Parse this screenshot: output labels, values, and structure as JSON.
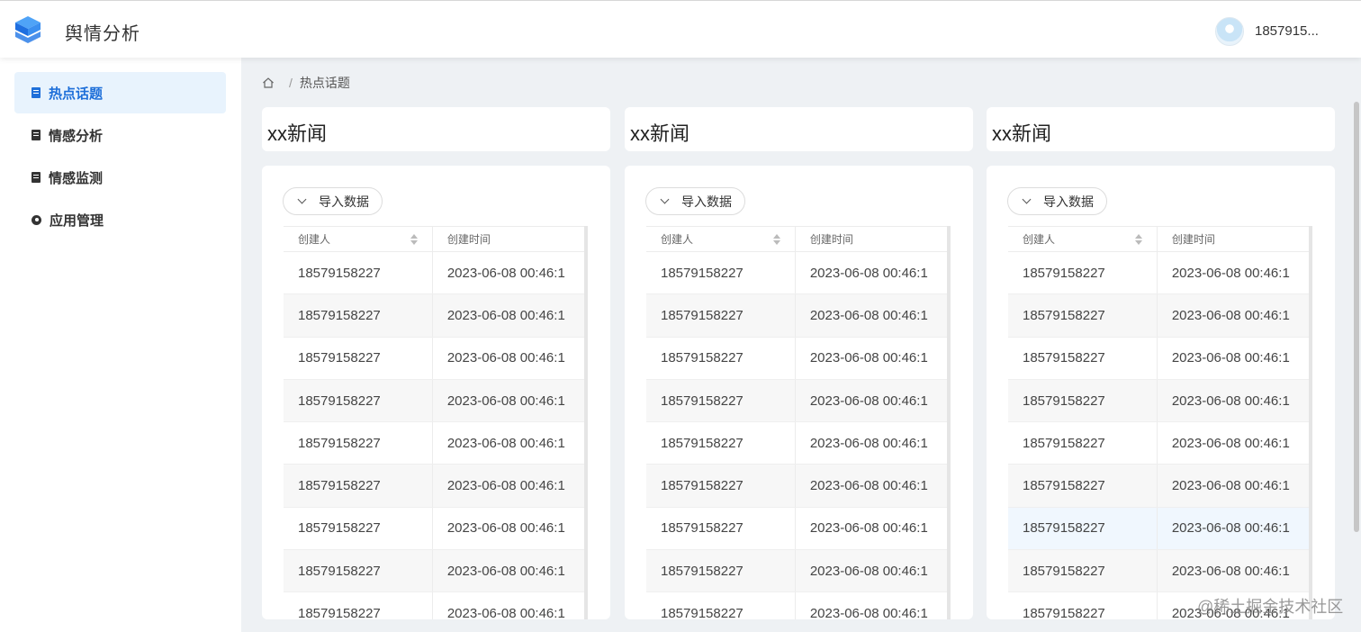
{
  "header": {
    "app_title": "舆情分析",
    "user_name": "1857915..."
  },
  "sidebar": {
    "items": [
      {
        "label": "热点话题",
        "icon": "document-icon",
        "active": true
      },
      {
        "label": "情感分析",
        "icon": "document-icon",
        "active": false
      },
      {
        "label": "情感监测",
        "icon": "document-icon",
        "active": false
      },
      {
        "label": "应用管理",
        "icon": "gear-icon",
        "active": false
      }
    ]
  },
  "breadcrumb": {
    "separator": "/",
    "current": "热点话题"
  },
  "panels": [
    {
      "title": "xx新闻",
      "import_label": "导入数据"
    },
    {
      "title": "xx新闻",
      "import_label": "导入数据"
    },
    {
      "title": "xx新闻",
      "import_label": "导入数据"
    }
  ],
  "table": {
    "columns": [
      "创建人",
      "创建时间"
    ],
    "rows": [
      [
        "18579158227",
        "2023-06-08 00:46:1"
      ],
      [
        "18579158227",
        "2023-06-08 00:46:1"
      ],
      [
        "18579158227",
        "2023-06-08 00:46:1"
      ],
      [
        "18579158227",
        "2023-06-08 00:46:1"
      ],
      [
        "18579158227",
        "2023-06-08 00:46:1"
      ],
      [
        "18579158227",
        "2023-06-08 00:46:1"
      ],
      [
        "18579158227",
        "2023-06-08 00:46:1"
      ],
      [
        "18579158227",
        "2023-06-08 00:46:1"
      ],
      [
        "18579158227",
        "2023-06-08 00:46:1"
      ]
    ]
  },
  "watermark": "@稀土掘金技术社区",
  "colors": {
    "accent": "#1e6fd9",
    "active_bg": "#e8f3fd",
    "page_bg": "#eef1f4"
  }
}
